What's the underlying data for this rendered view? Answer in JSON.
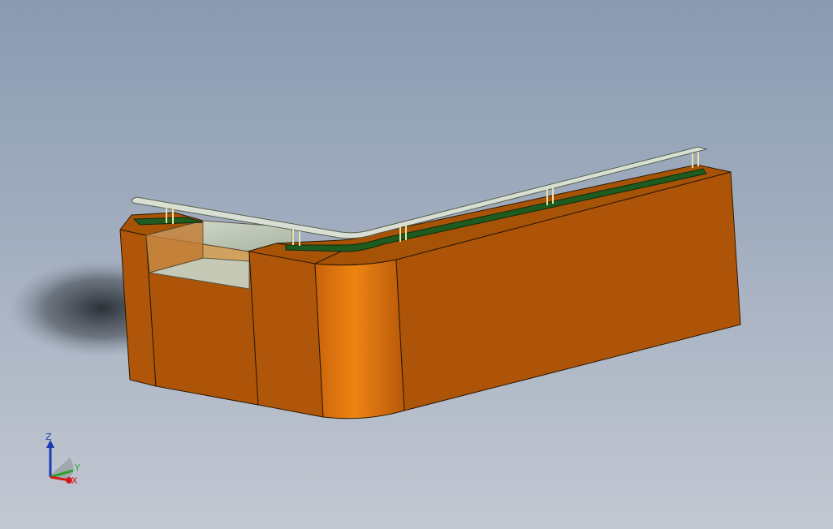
{
  "viewport": {
    "background_top": "#8a9bb1",
    "background_bottom": "#c3c8d2"
  },
  "model": {
    "body_color": "#b0560a",
    "body_highlight": "#e57a10",
    "top_cap_color": "#a65308",
    "trim_color": "#1f5a1f",
    "rail_color": "#d9dfd4",
    "glass_color": "#c9d2c2"
  },
  "triad": {
    "z_label": "Z",
    "y_label": "Y",
    "x_label": "X",
    "z_color": "#1d3bb3",
    "y_color": "#2aa52a",
    "x_color": "#d31b1b"
  }
}
